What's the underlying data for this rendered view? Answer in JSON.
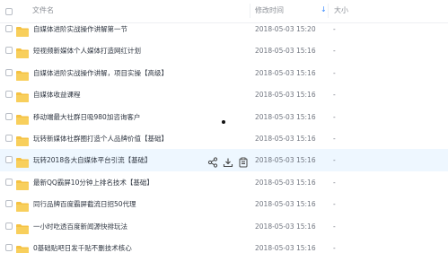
{
  "header": {
    "name_label": "文件名",
    "time_label": "修改时间",
    "size_label": "大小",
    "sort_icon": "sort-desc-icon"
  },
  "files": [
    {
      "name": "自媒体进阶实战操作讲解第一节",
      "time": "2018-05-03 15:20",
      "size": "-"
    },
    {
      "name": "短视频新媒体个人媒体打造网红计划",
      "time": "2018-05-03 15:16",
      "size": "-"
    },
    {
      "name": "自媒体进阶实战操作讲解，项目实操【高级】",
      "time": "2018-05-03 15:16",
      "size": "-"
    },
    {
      "name": "自媒体收益课程",
      "time": "2018-05-03 15:16",
      "size": "-"
    },
    {
      "name": "移动端最大社群日吸980加咨询客户",
      "time": "2018-05-03 15:16",
      "size": "-"
    },
    {
      "name": "玩转新媒体社群圈打造个人品牌价值【基础】",
      "time": "2018-05-03 15:16",
      "size": "-"
    },
    {
      "name": "玩转2018各大自媒体平台引流【基础】",
      "time": "2018-05-03 15:16",
      "size": "-"
    },
    {
      "name": "最新QQ霸屏10分钟上排名技术【基础】",
      "time": "2018-05-03 15:16",
      "size": "-"
    },
    {
      "name": "同行品牌百度霸屏截流日招50代理",
      "time": "2018-05-03 15:16",
      "size": "-"
    },
    {
      "name": "一小时吃透百度新闻源快排玩法",
      "time": "2018-05-03 15:16",
      "size": "-"
    },
    {
      "name": "0基础贴吧日发千贴不删技术核心",
      "time": "2018-05-03 15:16",
      "size": "-"
    }
  ],
  "row_actions": {
    "share_icon": "share-icon",
    "download_icon": "download-icon",
    "more_icon": "more-icon"
  },
  "colors": {
    "folder": "#f5c243",
    "hover_row": "#eef7ff",
    "accent": "#3b8cff"
  }
}
